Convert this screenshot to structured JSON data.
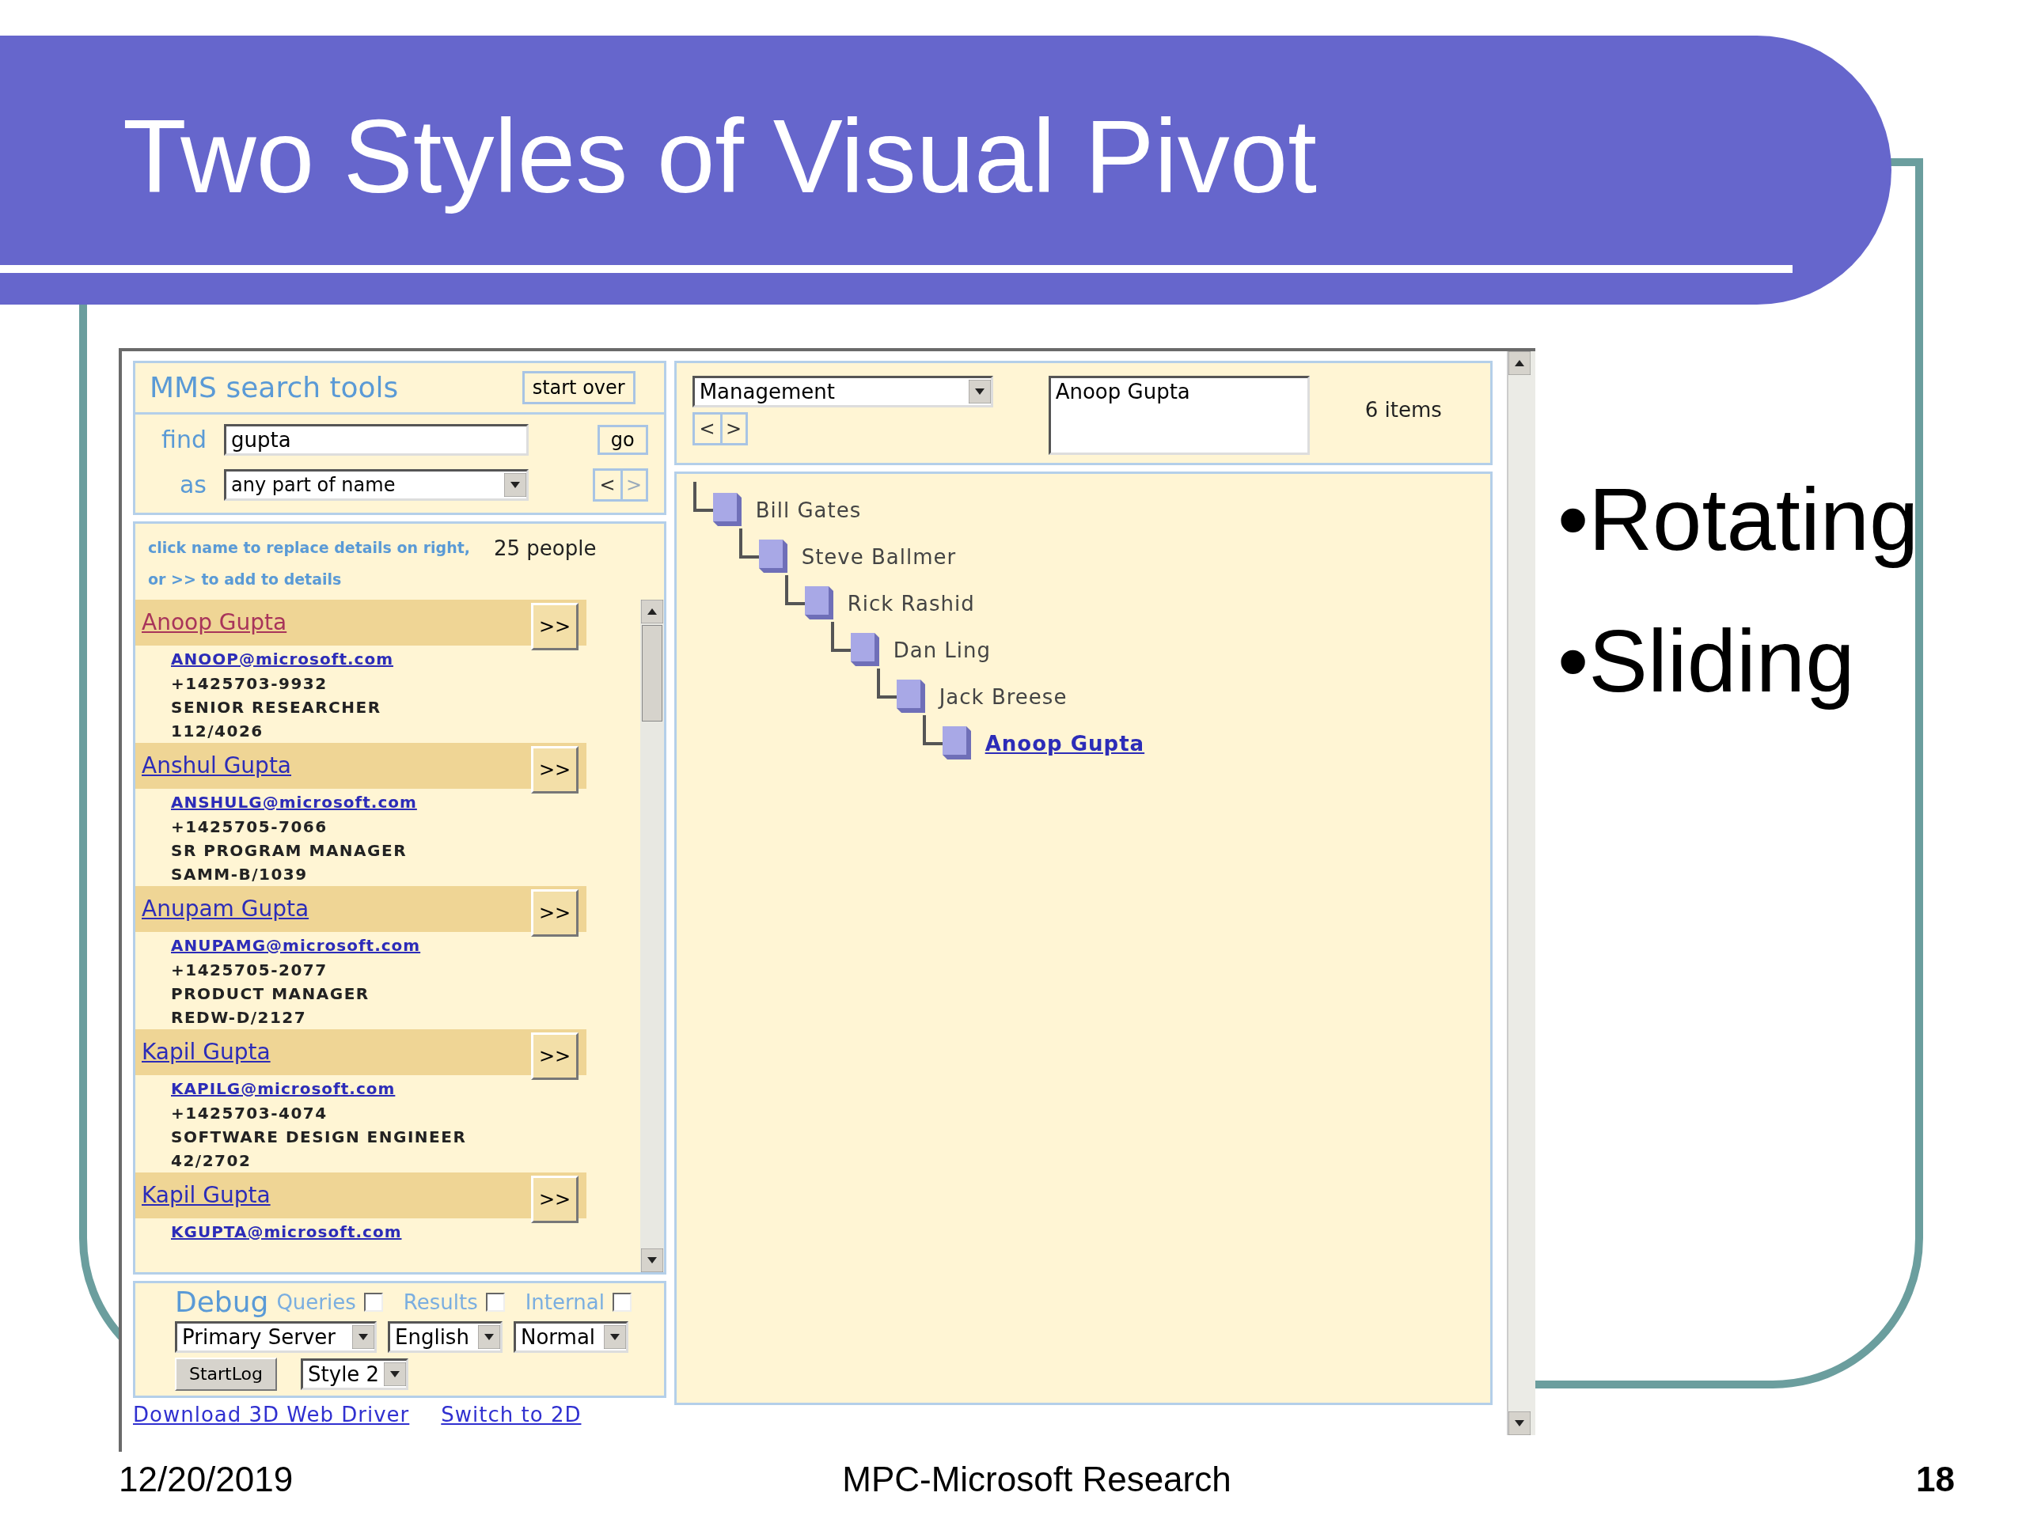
{
  "slide": {
    "title": "Two Styles of Visual Pivot",
    "bullets": [
      "•Rotating",
      "•Sliding"
    ],
    "footer": {
      "date": "12/20/2019",
      "center": "MPC-Microsoft Research",
      "page": "18"
    }
  },
  "search_tools": {
    "title": "MMS search tools",
    "start_over": "start over",
    "find_label": "find",
    "find_value": "gupta",
    "go": "go",
    "as_label": "as",
    "as_value": "any part of name",
    "prev": "<",
    "next": ">"
  },
  "results": {
    "hint_lines": [
      "click name to replace details on right,",
      "or >> to add to details"
    ],
    "count": "25 people",
    "people": [
      {
        "name": "Anoop Gupta",
        "selected": true,
        "add": ">>",
        "email": "ANOOP@microsoft.com",
        "details": [
          "+1425703-9932",
          "SENIOR RESEARCHER",
          "112/4026"
        ]
      },
      {
        "name": "Anshul Gupta",
        "selected": false,
        "add": ">>",
        "email": "ANSHULG@microsoft.com",
        "details": [
          "+1425705-7066",
          "SR PROGRAM MANAGER",
          "SAMM-B/1039"
        ]
      },
      {
        "name": "Anupam Gupta",
        "selected": false,
        "add": ">>",
        "email": "ANUPAMG@microsoft.com",
        "details": [
          "+1425705-2077",
          "PRODUCT MANAGER",
          "REDW-D/2127"
        ]
      },
      {
        "name": "Kapil Gupta",
        "selected": false,
        "add": ">>",
        "email": "KAPILG@microsoft.com",
        "details": [
          "+1425703-4074",
          "SOFTWARE DESIGN ENGINEER",
          "42/2702"
        ]
      },
      {
        "name": "Kapil Gupta",
        "selected": false,
        "add": ">>",
        "email": "KGUPTA@microsoft.com"
      }
    ]
  },
  "debug": {
    "title": "Debug",
    "options": [
      {
        "label": "Queries",
        "checked": false
      },
      {
        "label": "Results",
        "checked": false
      },
      {
        "label": "Internal",
        "checked": false
      }
    ],
    "selects": [
      "Primary Server",
      "English",
      "Normal"
    ],
    "start_log": "StartLog",
    "style_select": "Style 2"
  },
  "links": [
    "Download 3D Web Driver",
    "Switch to 2D"
  ],
  "pivot": {
    "dimension": "Management",
    "prev": "<",
    "next": ">",
    "selection": "Anoop Gupta",
    "count": "6 items",
    "tree": [
      {
        "name": "Bill Gates",
        "selected": false,
        "children": [
          {
            "name": "Steve Ballmer",
            "selected": false,
            "children": [
              {
                "name": "Rick Rashid",
                "selected": false,
                "children": [
                  {
                    "name": "Dan Ling",
                    "selected": false,
                    "children": [
                      {
                        "name": "Jack Breese",
                        "selected": false,
                        "children": [
                          {
                            "name": "Anoop Gupta",
                            "selected": true
                          }
                        ]
                      }
                    ]
                  }
                ]
              }
            ]
          }
        ]
      }
    ]
  }
}
